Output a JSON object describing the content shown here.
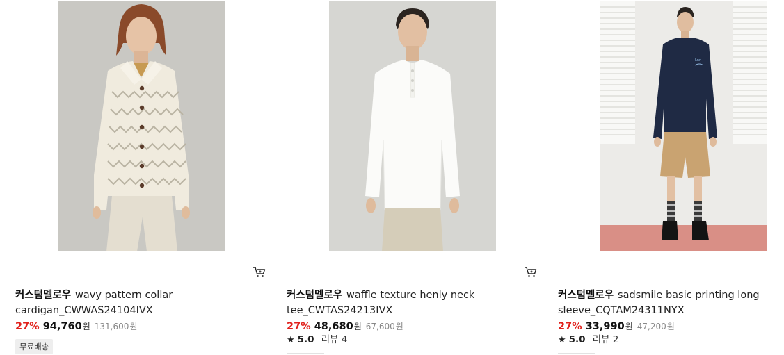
{
  "products": [
    {
      "brand": "커스텀멜로우",
      "name": "wavy pattern collar cardigan_CWWAS24104IVX",
      "discount": "27%",
      "price": "94,760",
      "currency": "원",
      "original_price": "131,600",
      "badge": "무료배송",
      "icon": "cart-icon"
    },
    {
      "brand": "커스텀멜로우",
      "name": "waffle texture henly neck tee_CWTAS24213IVX",
      "discount": "27%",
      "price": "48,680",
      "currency": "원",
      "original_price": "67,600",
      "rating": "5.0",
      "review_label": "리뷰 4",
      "icon": "cart-icon"
    },
    {
      "brand": "커스텀멜로우",
      "name": "sadsmile basic printing long sleeve_CQTAM24311NYX",
      "discount": "27%",
      "price": "33,990",
      "currency": "원",
      "original_price": "47,200",
      "rating": "5.0",
      "review_label": "리뷰 2",
      "icon": "cart-icon"
    }
  ]
}
